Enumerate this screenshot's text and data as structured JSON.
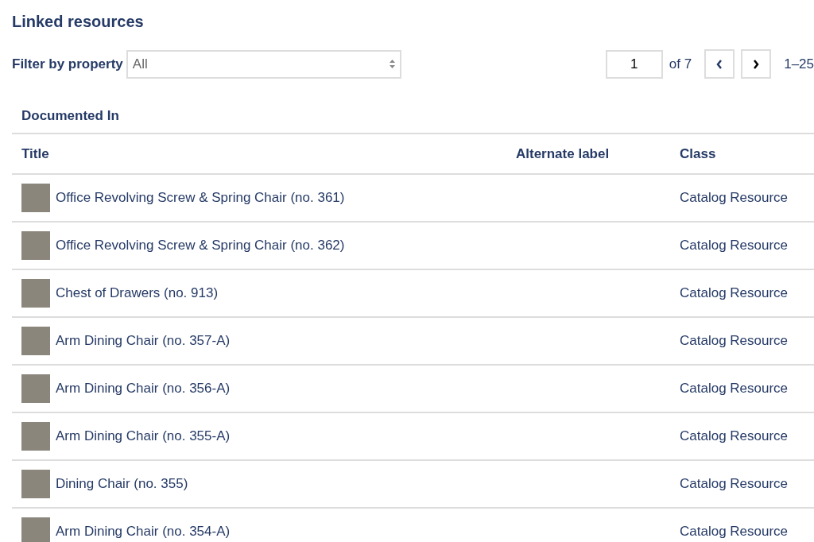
{
  "heading": "Linked resources",
  "filter": {
    "label": "Filter by property",
    "value": "All"
  },
  "pagination": {
    "page": "1",
    "of": "of 7",
    "range": "1–25"
  },
  "section": "Documented In",
  "table": {
    "columns": [
      "Title",
      "Alternate label",
      "Class"
    ],
    "rows": [
      {
        "title": "Office Revolving Screw & Spring Chair (no. 361)",
        "class": "Catalog Resource"
      },
      {
        "title": "Office Revolving Screw & Spring Chair (no. 362)",
        "class": "Catalog Resource"
      },
      {
        "title": "Chest of Drawers (no. 913)",
        "class": "Catalog Resource"
      },
      {
        "title": "Arm Dining Chair (no. 357-A)",
        "class": "Catalog Resource"
      },
      {
        "title": "Arm Dining Chair (no. 356-A)",
        "class": "Catalog Resource"
      },
      {
        "title": "Arm Dining Chair (no. 355-A)",
        "class": "Catalog Resource"
      },
      {
        "title": "Dining Chair (no. 355)",
        "class": "Catalog Resource"
      },
      {
        "title": "Arm Dining Chair (no. 354-A)",
        "class": "Catalog Resource"
      }
    ]
  }
}
